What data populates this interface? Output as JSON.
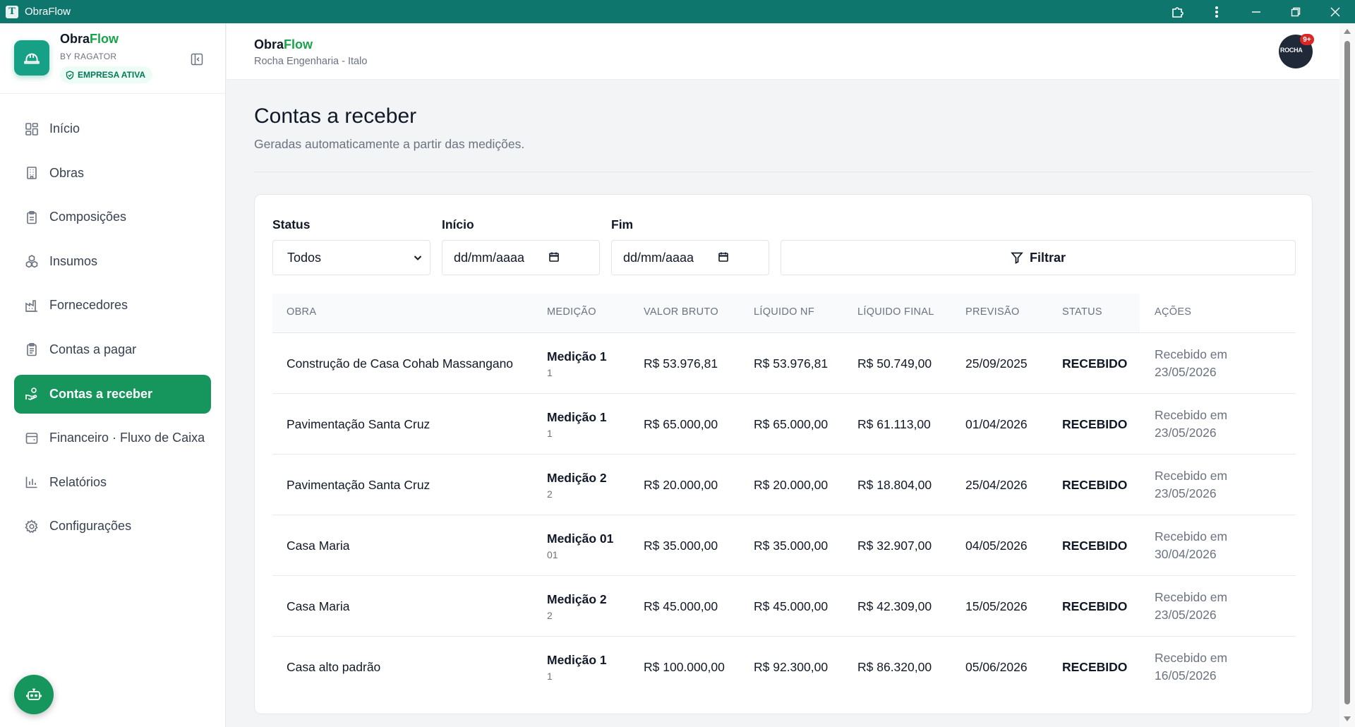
{
  "window": {
    "title": "ObraFlow"
  },
  "brand": {
    "name_a": "Obra",
    "name_b": "Flow",
    "by": "BY RAGATOR",
    "badge": "EMPRESA ATIVA",
    "color": "#16a085"
  },
  "header": {
    "name_a": "Obra",
    "name_b": "Flow",
    "company": "Rocha Engenharia - Italo",
    "avatar_text": "ROCHA",
    "avatar_badge": "9+"
  },
  "nav": [
    {
      "label": "Início",
      "icon": "grid-icon"
    },
    {
      "label": "Obras",
      "icon": "building-icon"
    },
    {
      "label": "Composições",
      "icon": "clipboard-icon"
    },
    {
      "label": "Insumos",
      "icon": "boxes-icon"
    },
    {
      "label": "Fornecedores",
      "icon": "factory-icon"
    },
    {
      "label": "Contas a pagar",
      "icon": "clipboard-list-icon"
    },
    {
      "label": "Contas a receber",
      "icon": "hand-coins-icon",
      "active": true
    },
    {
      "label": "Financeiro · Fluxo de Caixa",
      "icon": "wallet-icon"
    },
    {
      "label": "Relatórios",
      "icon": "bar-chart-icon"
    },
    {
      "label": "Configurações",
      "icon": "gear-icon"
    }
  ],
  "page": {
    "title": "Contas a receber",
    "subtitle": "Geradas automaticamente a partir das medições."
  },
  "filters": {
    "status_label": "Status",
    "status_value": "Todos",
    "start_label": "Início",
    "start_placeholder": "dd/mm/aaaa",
    "end_label": "Fim",
    "end_placeholder": "dd/mm/aaaa",
    "filter_button": "Filtrar"
  },
  "table": {
    "headers": [
      "OBRA",
      "MEDIÇÃO",
      "VALOR BRUTO",
      "LÍQUIDO NF",
      "LÍQUIDO FINAL",
      "PREVISÃO",
      "STATUS",
      "AÇÕES"
    ],
    "rows": [
      {
        "obra": "Construção de Casa Cohab Massangano",
        "medicao": "Medição 1",
        "medicao_num": "1",
        "bruto": "R$ 53.976,81",
        "liq_nf": "R$ 53.976,81",
        "liq_final": "R$ 50.749,00",
        "previsao": "25/09/2025",
        "status": "RECEBIDO",
        "acao_a": "Recebido em",
        "acao_b": "23/05/2026"
      },
      {
        "obra": "Pavimentação Santa Cruz",
        "medicao": "Medição 1",
        "medicao_num": "1",
        "bruto": "R$ 65.000,00",
        "liq_nf": "R$ 65.000,00",
        "liq_final": "R$ 61.113,00",
        "previsao": "01/04/2026",
        "status": "RECEBIDO",
        "acao_a": "Recebido em",
        "acao_b": "23/05/2026"
      },
      {
        "obra": "Pavimentação Santa Cruz",
        "medicao": "Medição 2",
        "medicao_num": "2",
        "bruto": "R$ 20.000,00",
        "liq_nf": "R$ 20.000,00",
        "liq_final": "R$ 18.804,00",
        "previsao": "25/04/2026",
        "status": "RECEBIDO",
        "acao_a": "Recebido em",
        "acao_b": "23/05/2026"
      },
      {
        "obra": "Casa Maria",
        "medicao": "Medição 01",
        "medicao_num": "01",
        "bruto": "R$ 35.000,00",
        "liq_nf": "R$ 35.000,00",
        "liq_final": "R$ 32.907,00",
        "previsao": "04/05/2026",
        "status": "RECEBIDO",
        "acao_a": "Recebido em",
        "acao_b": "30/04/2026"
      },
      {
        "obra": "Casa Maria",
        "medicao": "Medição 2",
        "medicao_num": "2",
        "bruto": "R$ 45.000,00",
        "liq_nf": "R$ 45.000,00",
        "liq_final": "R$ 42.309,00",
        "previsao": "15/05/2026",
        "status": "RECEBIDO",
        "acao_a": "Recebido em",
        "acao_b": "23/05/2026"
      },
      {
        "obra": "Casa alto padrão",
        "medicao": "Medição 1",
        "medicao_num": "1",
        "bruto": "R$ 100.000,00",
        "liq_nf": "R$ 92.300,00",
        "liq_final": "R$ 86.320,00",
        "previsao": "05/06/2026",
        "status": "RECEBIDO",
        "acao_a": "Recebido em",
        "acao_b": "16/05/2026"
      }
    ]
  },
  "colors": {
    "titlebar": "#0f766e",
    "accent": "#16955c"
  }
}
